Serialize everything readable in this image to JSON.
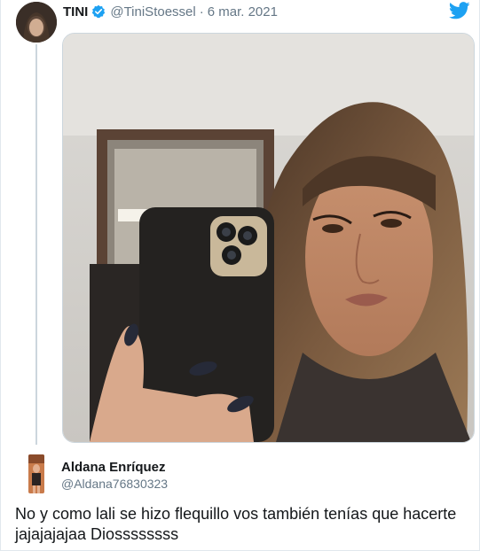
{
  "tweet": {
    "display_name": "TINI",
    "handle": "@TiniStoessel",
    "separator": "·",
    "date": "6 mar. 2021",
    "verified": true,
    "avatar_icon": "profile-photo",
    "media_icon": "selfie-photo"
  },
  "reply": {
    "display_name": "Aldana Enríquez",
    "handle": "@Aldana76830323",
    "text": "No y como lali se hizo flequillo vos también tenías que hacerte jajajajajaa Diossssssss",
    "avatar_icon": "profile-photo"
  },
  "colors": {
    "twitter_blue": "#1da1f2",
    "text_primary": "#14171a",
    "text_secondary": "#657786",
    "divider": "#ccd6dd"
  },
  "icons": {
    "brand": "twitter-bird-icon",
    "verified": "verified-badge-icon"
  }
}
